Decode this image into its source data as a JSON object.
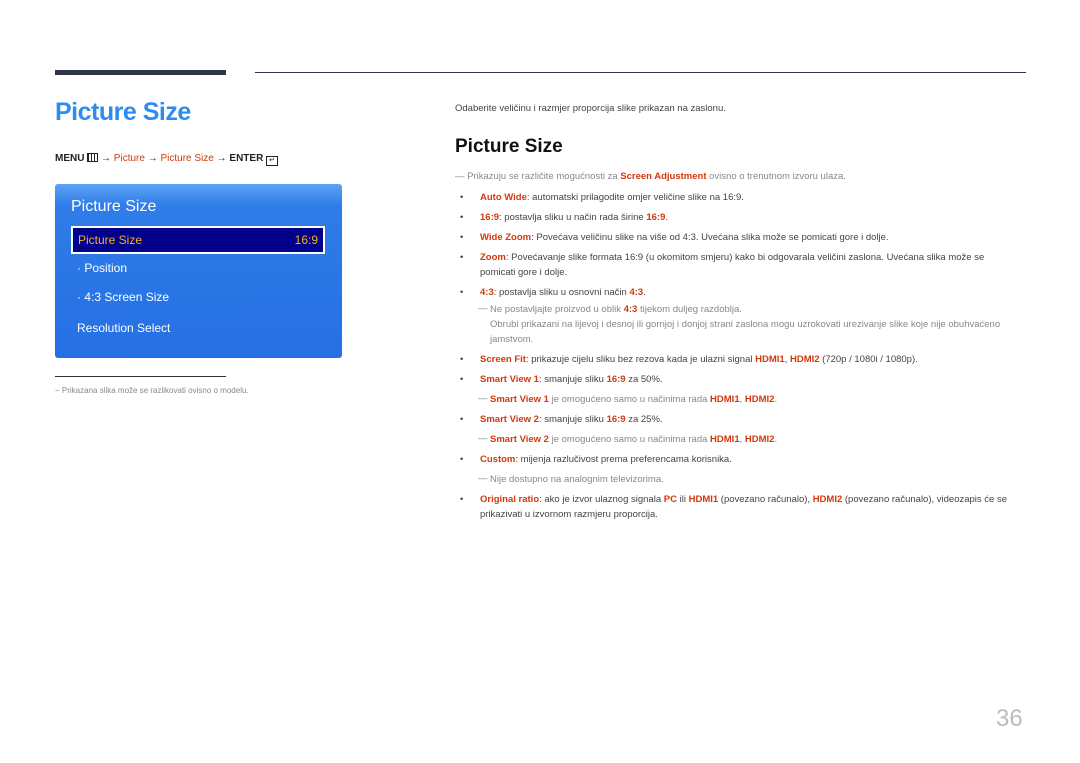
{
  "page": {
    "title": "Picture Size",
    "page_number": "36"
  },
  "menu_path": {
    "menu": "MENU",
    "arrow": "→",
    "picture": "Picture",
    "picture_size": "Picture Size",
    "enter": "ENTER"
  },
  "osd": {
    "title": "Picture Size",
    "selected_label": "Picture Size",
    "selected_value": "16:9",
    "items": [
      "· Position",
      "· 4:3 Screen Size",
      "Resolution Select"
    ]
  },
  "footnote": "−  Prikazana slika može se razlikovati ovisno o modelu.",
  "content": {
    "intro": "Odaberite veličinu i razmjer proporcija slike prikazan na zaslonu.",
    "section_title": "Picture Size",
    "note_top": {
      "dash": "―",
      "pre": "Prikazuju se različite mogućnosti za ",
      "highlight": "Screen Adjustment",
      "post": " ovisno o trenutnom izvoru ulaza."
    },
    "bullet": "•",
    "items": [
      {
        "term": "Auto Wide",
        "text": ": automatski prilagodite omjer veličine slike na 16:9."
      },
      {
        "term": "16:9",
        "text": ": postavlja sliku u način rada širine ",
        "term2": "16:9",
        "text2": "."
      },
      {
        "term": "Wide Zoom",
        "text": ": Povećava veličinu slike na više od 4:3. Uvećana slika može se pomicati gore i dolje."
      },
      {
        "term": "Zoom",
        "text": ": Povećavanje slike formata 16:9 (u okomitom smjeru) kako bi odgovarala veličini zaslona. Uvećana slika može se pomicati gore i dolje."
      },
      {
        "term": "4:3",
        "text": ": postavlja sliku u osnovni način ",
        "term2": "4:3",
        "text2": "."
      },
      {
        "term": "Screen Fit",
        "text": ": prikazuje cijelu sliku bez rezova kada je ulazni signal ",
        "term2": "HDMI1",
        "text2": ", ",
        "term3": "HDMI2",
        "text3": " (720p / 1080i / 1080p)."
      },
      {
        "term": "Smart View 1",
        "text": ": smanjuje sliku ",
        "term2": "16:9",
        "text2": " za 50%."
      },
      {
        "term": "Smart View 2",
        "text": ": smanjuje sliku ",
        "term2": "16:9",
        "text2": " za 25%."
      },
      {
        "term": "Custom",
        "text": ": mijenja razlučivost prema preferencama korisnika."
      },
      {
        "term": "Original ratio",
        "text": ": ako je izvor ulaznog signala ",
        "term2": "PC",
        "text2": " ili ",
        "term3": "HDMI1",
        "text3": " (povezano računalo), ",
        "term4": "HDMI2",
        "text4": " (povezano računalo), videozapis će se prikazivati u izvornom razmjeru proporcija."
      }
    ],
    "notes": {
      "four_three_a": {
        "pre": "Ne postavljajte proizvod u oblik ",
        "term": "4:3",
        "post": " tijekom duljeg razdoblja."
      },
      "four_three_b": "Obrubi prikazani na lijevoj i desnoj ili gornjoj i donjoj strani zaslona mogu uzrokovati urezivanje slike koje nije obuhvaćeno jamstvom.",
      "sv1": {
        "term": "Smart View 1",
        "mid": " je omogućeno samo u načinima rada ",
        "t2": "HDMI1",
        "sep": ", ",
        "t3": "HDMI2",
        "end": "."
      },
      "sv2": {
        "term": "Smart View 2",
        "mid": " je omogućeno samo u načinima rada ",
        "t2": "HDMI1",
        "sep": ", ",
        "t3": "HDMI2",
        "end": "."
      },
      "custom": "Nije dostupno na analognim televizorima."
    }
  },
  "colors": {
    "title_blue": "#2d8cf0",
    "accent_red": "#d4380d",
    "osd_blue": "#256fe3",
    "osd_selected_bg": "#00008b",
    "osd_selected_text": "#f5b324"
  }
}
